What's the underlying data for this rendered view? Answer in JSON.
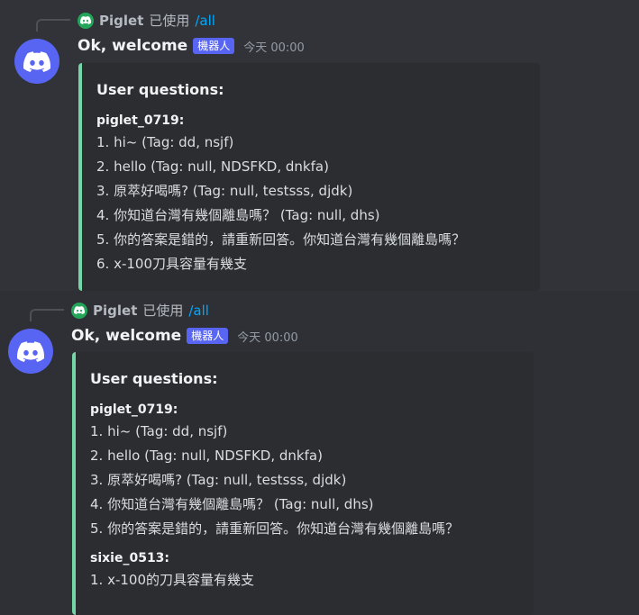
{
  "messages": [
    {
      "reply": {
        "name": "Piglet",
        "action": "已使用",
        "command": "/all"
      },
      "author": "Ok, welcome",
      "badge": "機器人",
      "timestamp": "今天 00:00",
      "embed": {
        "title": "User questions:",
        "fields": [
          {
            "name": "piglet_0719:",
            "lines": [
              "1. hi~ (Tag: dd, nsjf)",
              "2. hello (Tag: null, NDSFKD, dnkfa)",
              "3. 原萃好喝嗎? (Tag: null, testsss, djdk)",
              "4. 你知道台灣有幾個離島嗎？ (Tag: null, dhs)",
              "5. 你的答案是錯的，請重新回答。你知道台灣有幾個離島嗎？",
              "6. x-100刀具容量有幾支"
            ]
          }
        ]
      }
    },
    {
      "reply": {
        "name": "Piglet",
        "action": "已使用",
        "command": "/all"
      },
      "author": "Ok, welcome",
      "badge": "機器人",
      "timestamp": "今天 00:00",
      "embed": {
        "title": "User questions:",
        "fields": [
          {
            "name": "piglet_0719:",
            "lines": [
              "1. hi~ (Tag: dd, nsjf)",
              "2. hello (Tag: null, NDSFKD, dnkfa)",
              "3. 原萃好喝嗎? (Tag: null, testsss, djdk)",
              "4. 你知道台灣有幾個離島嗎？ (Tag: null, dhs)",
              "5. 你的答案是錯的，請重新回答。你知道台灣有幾個離島嗎？"
            ]
          },
          {
            "name": "sixie_0513:",
            "lines": [
              "1. x-100的刀具容量有幾支"
            ]
          }
        ]
      }
    }
  ],
  "colors": {
    "background": "#313338",
    "embed_background": "#2b2d31",
    "embed_accent": "#74d6a6",
    "avatar": "#5865f2",
    "mini_avatar": "#23a55a",
    "command": "#00a8fc"
  },
  "icons": {
    "avatar": "discord-logo-icon",
    "mini_avatar": "discord-logo-icon"
  }
}
